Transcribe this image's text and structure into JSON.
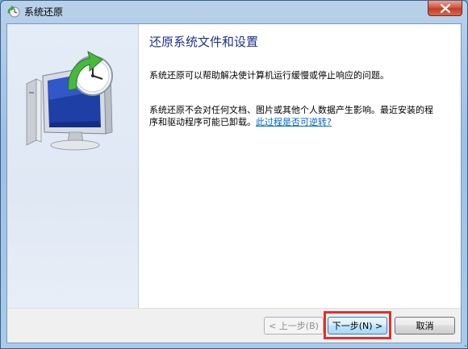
{
  "window": {
    "title": "系统还原",
    "icon": "system-restore-icon",
    "close_icon": "close-icon"
  },
  "content": {
    "heading": "还原系统文件和设置",
    "paragraph1": "系统还原可以帮助解决使计算机运行缓慢或停止响应的问题。",
    "paragraph2_text": "系统还原不会对任何文档、图片或其他个人数据产生影响。最近安装的程序和驱动程序可能已卸载。",
    "paragraph2_link": "此过程是否可逆转?",
    "illustration": "system-restore-illustration"
  },
  "buttons": {
    "back": "< 上一步(B)",
    "next": "下一步(N) >",
    "cancel": "取消"
  },
  "colors": {
    "heading": "#1e3287",
    "link": "#0066cc",
    "highlight": "#e0302f"
  }
}
